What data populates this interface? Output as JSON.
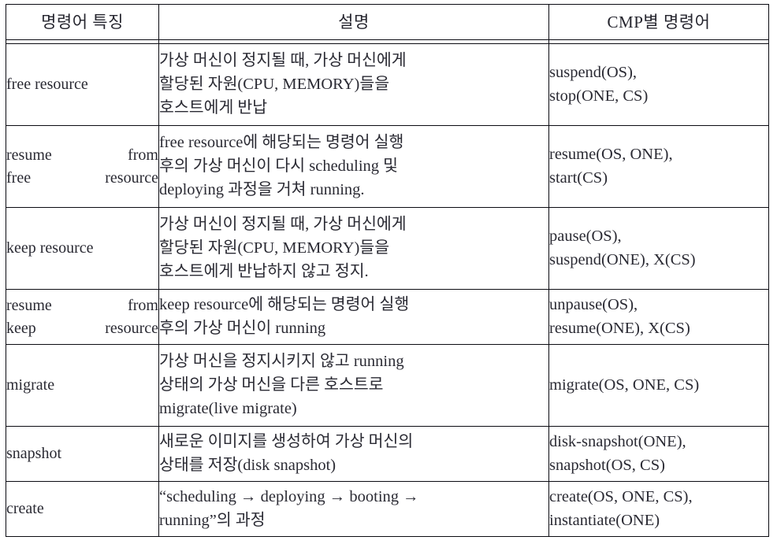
{
  "table": {
    "columns": [
      {
        "key": "feature",
        "header": "명령어 특징"
      },
      {
        "key": "description",
        "header": "설명"
      },
      {
        "key": "cmp_commands",
        "header": "CMP별 명령어"
      }
    ],
    "header_bg": "#dedeef",
    "border_color": "#0b0b12",
    "rows": [
      {
        "feature": "free resource",
        "description": "가상 머신이 정지될 때, 가상 머신에게\n할당된 자원(CPU, MEMORY)들을\n호스트에게 반납",
        "cmp_commands": "suspend(OS),\nstop(ONE, CS)"
      },
      {
        "feature": "resume    from\nfree resource",
        "description": "free resource에 해당되는 명령어 실행\n후의 가상 머신이 다시 scheduling 및\ndeploying 과정을 거쳐 running.",
        "cmp_commands": "resume(OS, ONE),\nstart(CS)"
      },
      {
        "feature": "keep resource",
        "description": "가상 머신이 정지될 때, 가상 머신에게\n할당된 자원(CPU, MEMORY)들을\n호스트에게 반납하지 않고 정지.",
        "cmp_commands": "pause(OS),\nsuspend(ONE), X(CS)"
      },
      {
        "feature": "resume    from\nkeep resource",
        "description": "keep resource에 해당되는 명령어 실행\n후의 가상 머신이 running",
        "cmp_commands": "unpause(OS),\nresume(ONE), X(CS)"
      },
      {
        "feature": "migrate",
        "description": "가상 머신을 정지시키지 않고 running\n상태의 가상 머신을 다른 호스트로\nmigrate(live migrate)",
        "cmp_commands": "migrate(OS, ONE, CS)"
      },
      {
        "feature": "snapshot",
        "description": "새로운 이미지를 생성하여 가상 머신의\n상태를 저장(disk snapshot)",
        "cmp_commands": "disk-snapshot(ONE),\nsnapshot(OS, CS)"
      },
      {
        "feature": "create",
        "description": "“scheduling → deploying → booting →\nrunning”의 과정",
        "cmp_commands": "create(OS, ONE, CS),\ninstantiate(ONE)"
      }
    ]
  }
}
